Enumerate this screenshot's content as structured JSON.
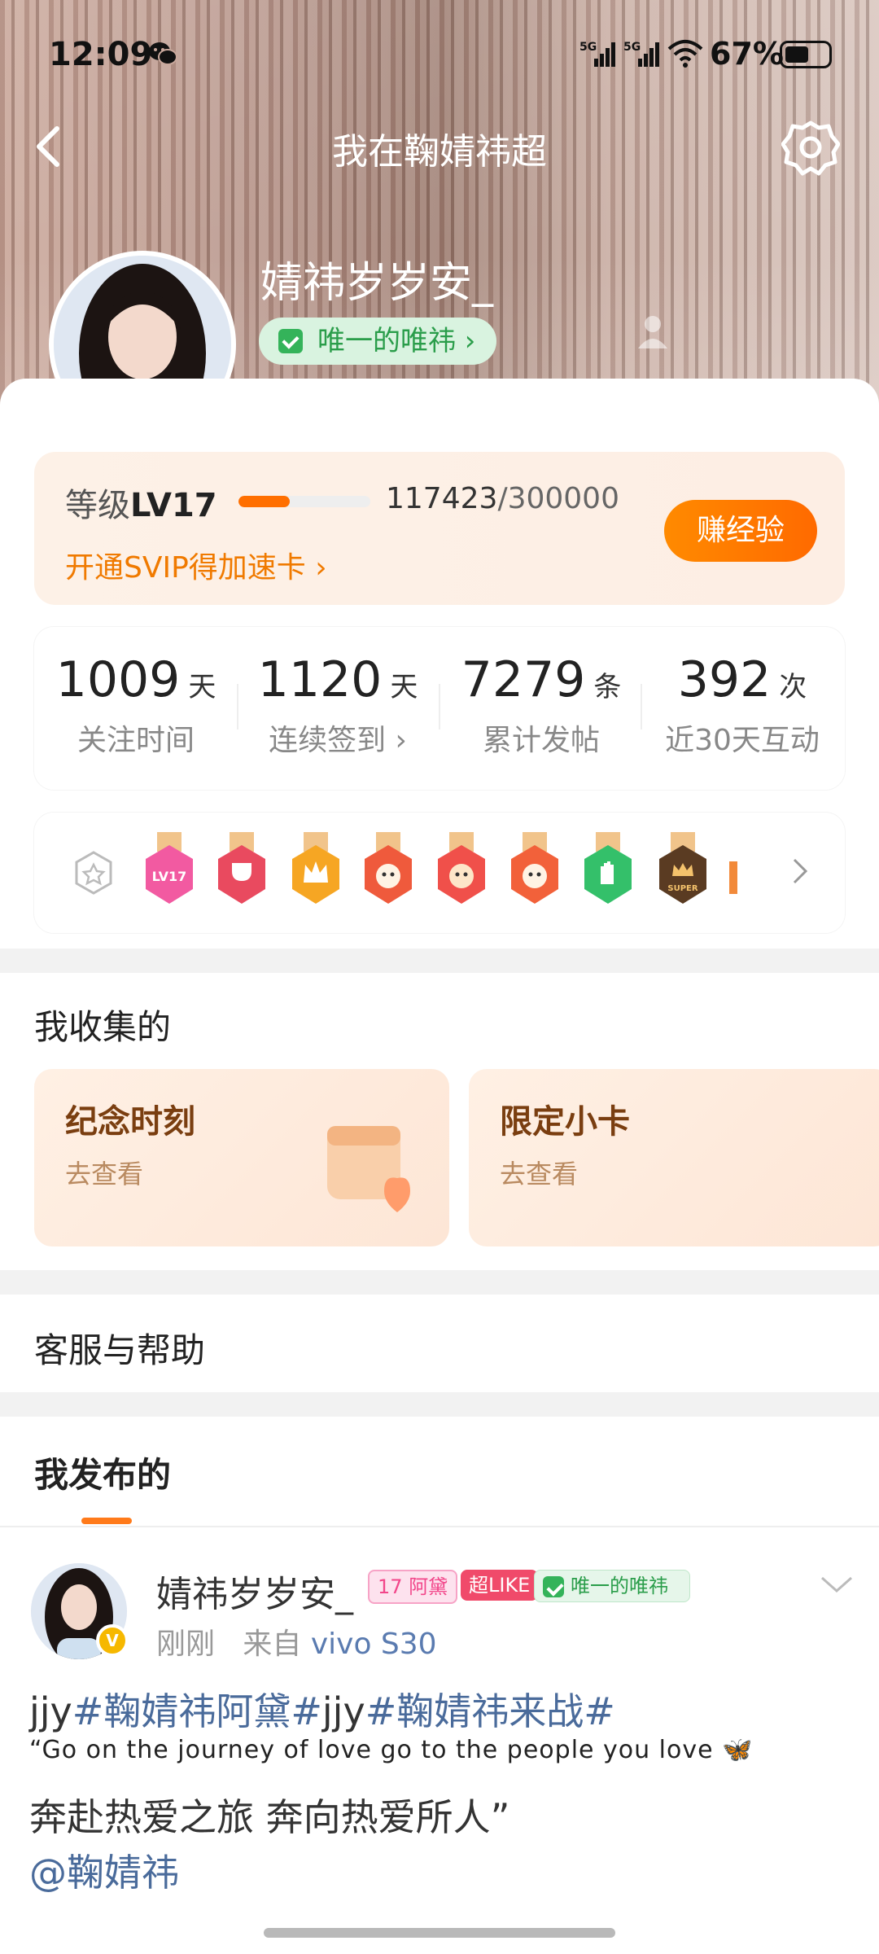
{
  "status_bar": {
    "time": "12:09",
    "net1": "5G",
    "net2": "5G",
    "battery": "67%"
  },
  "header": {
    "title": "我在鞠婧祎超"
  },
  "profile": {
    "name": "婧祎岁岁安_",
    "tag": "唯一的唯祎 ›",
    "verified": "V"
  },
  "level": {
    "label": "等级",
    "value": "LV17",
    "current": "117423",
    "total": "/300000",
    "progress": 0.391,
    "svip": "开通SVIP得加速卡 ›",
    "earn_button": "赚经验"
  },
  "stats": [
    {
      "value": "1009",
      "unit": "天",
      "label": "关注时间"
    },
    {
      "value": "1120",
      "unit": "天",
      "label": "连续签到 ›"
    },
    {
      "value": "7279",
      "unit": "条",
      "label": "累计发帖"
    },
    {
      "value": "392",
      "unit": "次",
      "label": "近30天互动"
    }
  ],
  "collect": {
    "title": "我收集的",
    "cards": [
      {
        "title": "纪念时刻",
        "sub": "去查看"
      },
      {
        "title": "限定小卡",
        "sub": "去查看"
      }
    ]
  },
  "help": {
    "title": "客服与帮助"
  },
  "posts_tab": {
    "title": "我发布的"
  },
  "post": {
    "name": "婧祎岁岁安_",
    "badge_level": "17",
    "badge_name": "阿黛",
    "superlike": "超LIKE",
    "tag": "唯一的唯祎",
    "time": "刚刚",
    "from": "来自",
    "device": "vivo S30",
    "line1": {
      "t1": "jjy",
      "h1": "#鞠婧祎阿黛#",
      "t2": "jjy",
      "h2": "#鞠婧祎来战#"
    },
    "line2": "“Go on the journey of love go to the people you love",
    "line2_emoji": "🦋",
    "line3": "奔赴热爱之旅 奔向热爱所人”",
    "mention": "@鞠婧祎"
  },
  "colors": {
    "accent": "#ff7a1a",
    "hashtag": "#4a6b9b",
    "green": "#34b35a"
  }
}
